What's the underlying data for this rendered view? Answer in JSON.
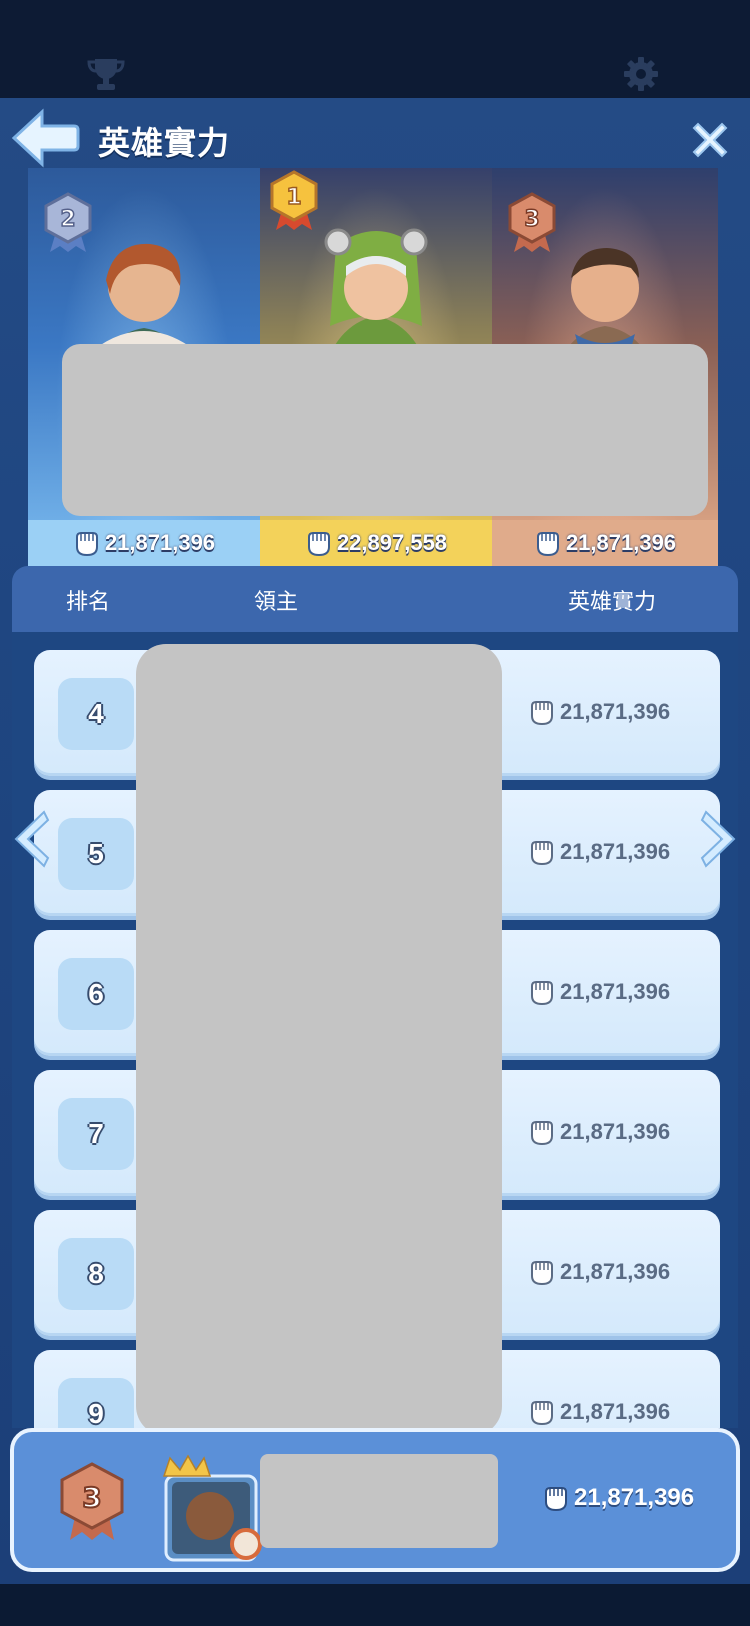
{
  "header": {
    "title": "英雄實力",
    "icons": {
      "trophy": "trophy-icon",
      "settings": "gear-icon",
      "back": "back-arrow-icon",
      "close": "close-icon"
    }
  },
  "podium": [
    {
      "rank": "2",
      "power": "21,871,396",
      "color": "#9bd0f5"
    },
    {
      "rank": "1",
      "power": "22,897,558",
      "color": "#f3d25a"
    },
    {
      "rank": "3",
      "power": "21,871,396",
      "color": "#e0ab8b"
    }
  ],
  "table": {
    "col_rank": "排名",
    "col_lord": "領主",
    "col_power": "英雄實力",
    "rows": [
      {
        "rank": "4",
        "power": "21,871,396"
      },
      {
        "rank": "5",
        "power": "21,871,396"
      },
      {
        "rank": "6",
        "power": "21,871,396"
      },
      {
        "rank": "7",
        "power": "21,871,396"
      },
      {
        "rank": "8",
        "power": "21,871,396"
      },
      {
        "rank": "9",
        "power": "21,871,396"
      }
    ]
  },
  "self": {
    "rank": "3",
    "power": "21,871,396"
  },
  "colors": {
    "accent": "#3c67ad",
    "row_bg": "#dcecfd",
    "gold": "#f3d25a"
  }
}
